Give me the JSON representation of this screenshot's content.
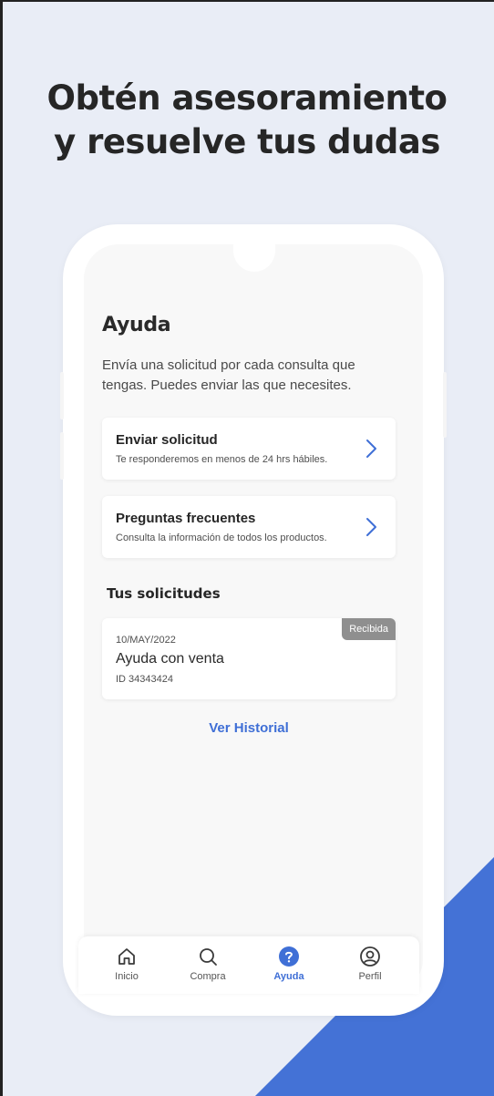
{
  "headline": {
    "line1": "Obtén asesoramiento",
    "line2": "y resuelve tus dudas"
  },
  "colors": {
    "background": "#e9edf6",
    "accent": "#4472d6",
    "link": "#3f6fd6",
    "badge": "#8f8f8f"
  },
  "screen": {
    "title": "Ayuda",
    "description": "Envía una solicitud por cada consulta que tengas. Puedes enviar las que necesites.",
    "cards": [
      {
        "title": "Enviar solicitud",
        "subtitle": "Te responderemos en menos de 24 hrs hábiles.",
        "icon": "chevron-right-icon"
      },
      {
        "title": "Preguntas frecuentes",
        "subtitle": "Consulta la información de todos los productos.",
        "icon": "chevron-right-icon"
      }
    ],
    "requests_section": {
      "title": "Tus solicitudes",
      "items": [
        {
          "date": "10/MAY/2022",
          "title": "Ayuda con venta",
          "id": "ID 34343424",
          "status": "Recibida"
        }
      ]
    },
    "history_link": "Ver Historial"
  },
  "bottom_nav": {
    "items": [
      {
        "label": "Inicio",
        "icon": "home-icon",
        "active": false
      },
      {
        "label": "Compra",
        "icon": "search-icon",
        "active": false
      },
      {
        "label": "Ayuda",
        "icon": "help-icon",
        "active": true
      },
      {
        "label": "Perfil",
        "icon": "user-icon",
        "active": false
      }
    ]
  }
}
